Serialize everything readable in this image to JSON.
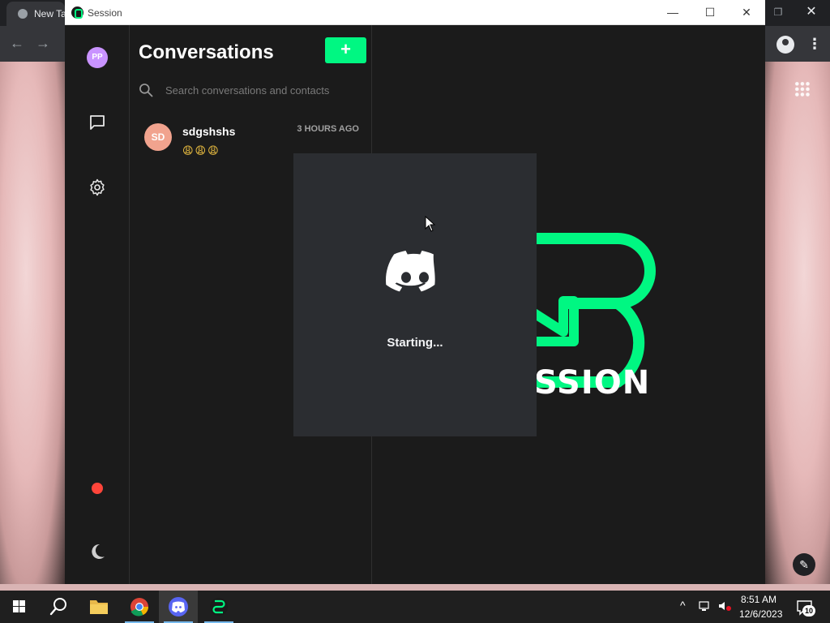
{
  "chrome": {
    "tab_title": "New Tab",
    "back_glyph": "←",
    "forward_glyph": "→",
    "restore_glyph": "❐",
    "close_glyph": "✕",
    "menu_glyph": "⋮",
    "edit_glyph": "✎"
  },
  "window": {
    "title": "Session",
    "minimize_glyph": "—",
    "maximize_glyph": "☐",
    "close_glyph": "✕"
  },
  "sidebar": {
    "avatar_initials": "PP",
    "status_color": "#ff453a"
  },
  "conversations": {
    "title": "Conversations",
    "new_button_label": "+",
    "search_placeholder": "Search conversations and contacts",
    "items": [
      {
        "initials": "SD",
        "name": "sdgshshs",
        "time": "3 HOURS AGO",
        "preview": "😩😩😩"
      }
    ]
  },
  "main": {
    "brand_text": "SSION",
    "accent_color": "#00f782"
  },
  "discord_splash": {
    "status": "Starting..."
  },
  "taskbar": {
    "time": "8:51 AM",
    "date": "12/6/2023",
    "notification_count": "10",
    "tray_chevron": "^"
  }
}
